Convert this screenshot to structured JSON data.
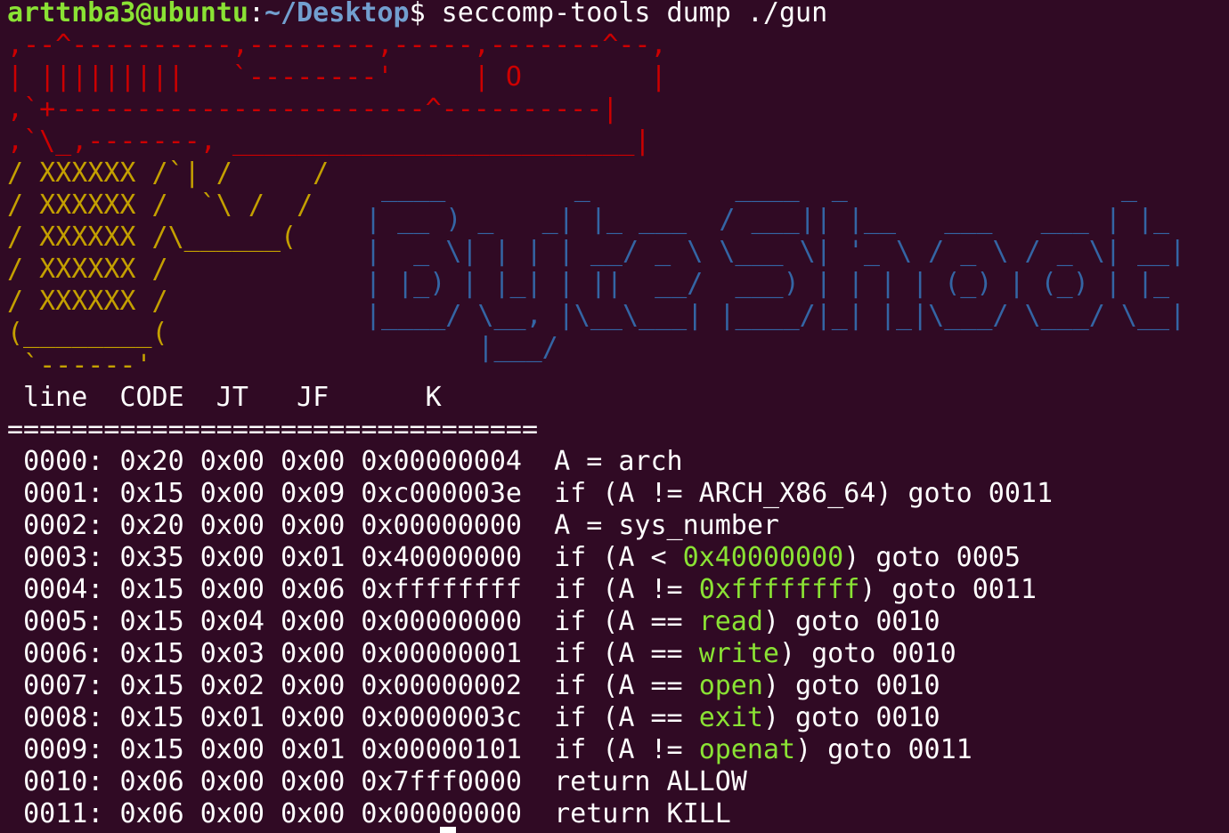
{
  "prompt": {
    "user_host": "arttnba3@ubuntu",
    "colon": ":",
    "path": "~/Desktop",
    "dollar": "$",
    "command": " seccomp-tools dump ./gun"
  },
  "banner": {
    "gun_lines": [
      ",--^----------,--------,-----,-------^--,",
      "| |||||||||   `--------'     | O        |",
      ",`+-----------------------^----------|",
      ",`\\_,-------, _________________________|",
      "/ XXXXXX /`| /     /",
      "/ XXXXXX /  `\\ /  /",
      "/ XXXXXX /\\______(",
      "/ XXXXXX /",
      "/ XXXXXX /",
      "(________(",
      " `------'"
    ],
    "logo_lines": [
      " ____        _         ____  _                 _   ",
      "| __ ) _   _| |_ ___  / ___|| |__   ___   ___ | |_ ",
      "|  _ \\| | | | __/ _ \\ \\___ \\| '_ \\ / _ \\ / _ \\| __|",
      "| |_) | |_| | ||  __/  ___) | | | | (_) | (_) | |_ ",
      "|____/ \\__, |\\__\\___| |____/|_| |_|\\___/ \\___/ \\__|",
      "       |___/                                       "
    ]
  },
  "table": {
    "header": " line  CODE  JT   JF      K",
    "separator": "=================================",
    "rows": [
      {
        "line": "0000:",
        "code": "0x20",
        "jt": "0x00",
        "jf": "0x00",
        "k": "0x00000004",
        "pre": "A = arch",
        "hl": "",
        "post": ""
      },
      {
        "line": "0001:",
        "code": "0x15",
        "jt": "0x00",
        "jf": "0x09",
        "k": "0xc000003e",
        "pre": "if (A != ARCH_X86_64) goto 0011",
        "hl": "",
        "post": ""
      },
      {
        "line": "0002:",
        "code": "0x20",
        "jt": "0x00",
        "jf": "0x00",
        "k": "0x00000000",
        "pre": "A = sys_number",
        "hl": "",
        "post": ""
      },
      {
        "line": "0003:",
        "code": "0x35",
        "jt": "0x00",
        "jf": "0x01",
        "k": "0x40000000",
        "pre": "if (A < ",
        "hl": "0x40000000",
        "post": ") goto 0005"
      },
      {
        "line": "0004:",
        "code": "0x15",
        "jt": "0x00",
        "jf": "0x06",
        "k": "0xffffffff",
        "pre": "if (A != ",
        "hl": "0xffffffff",
        "post": ") goto 0011"
      },
      {
        "line": "0005:",
        "code": "0x15",
        "jt": "0x04",
        "jf": "0x00",
        "k": "0x00000000",
        "pre": "if (A == ",
        "hl": "read",
        "post": ") goto 0010"
      },
      {
        "line": "0006:",
        "code": "0x15",
        "jt": "0x03",
        "jf": "0x00",
        "k": "0x00000001",
        "pre": "if (A == ",
        "hl": "write",
        "post": ") goto 0010"
      },
      {
        "line": "0007:",
        "code": "0x15",
        "jt": "0x02",
        "jf": "0x00",
        "k": "0x00000002",
        "pre": "if (A == ",
        "hl": "open",
        "post": ") goto 0010"
      },
      {
        "line": "0008:",
        "code": "0x15",
        "jt": "0x01",
        "jf": "0x00",
        "k": "0x0000003c",
        "pre": "if (A == ",
        "hl": "exit",
        "post": ") goto 0010"
      },
      {
        "line": "0009:",
        "code": "0x15",
        "jt": "0x00",
        "jf": "0x01",
        "k": "0x00000101",
        "pre": "if (A != ",
        "hl": "openat",
        "post": ") goto 0011"
      },
      {
        "line": "0010:",
        "code": "0x06",
        "jt": "0x00",
        "jf": "0x00",
        "k": "0x7fff0000",
        "pre": "return ALLOW",
        "hl": "",
        "post": ""
      },
      {
        "line": "0011:",
        "code": "0x06",
        "jt": "0x00",
        "jf": "0x00",
        "k": "0x00000000",
        "pre": "return KILL",
        "hl": "",
        "post": ""
      }
    ]
  },
  "colors": {
    "background": "#300a24",
    "prompt_user": "#8ae234",
    "prompt_path": "#729fcf",
    "gun_top": "#cc0000",
    "gun_bottom": "#c4a000",
    "logo": "#3465a4",
    "highlight": "#8ae234"
  }
}
